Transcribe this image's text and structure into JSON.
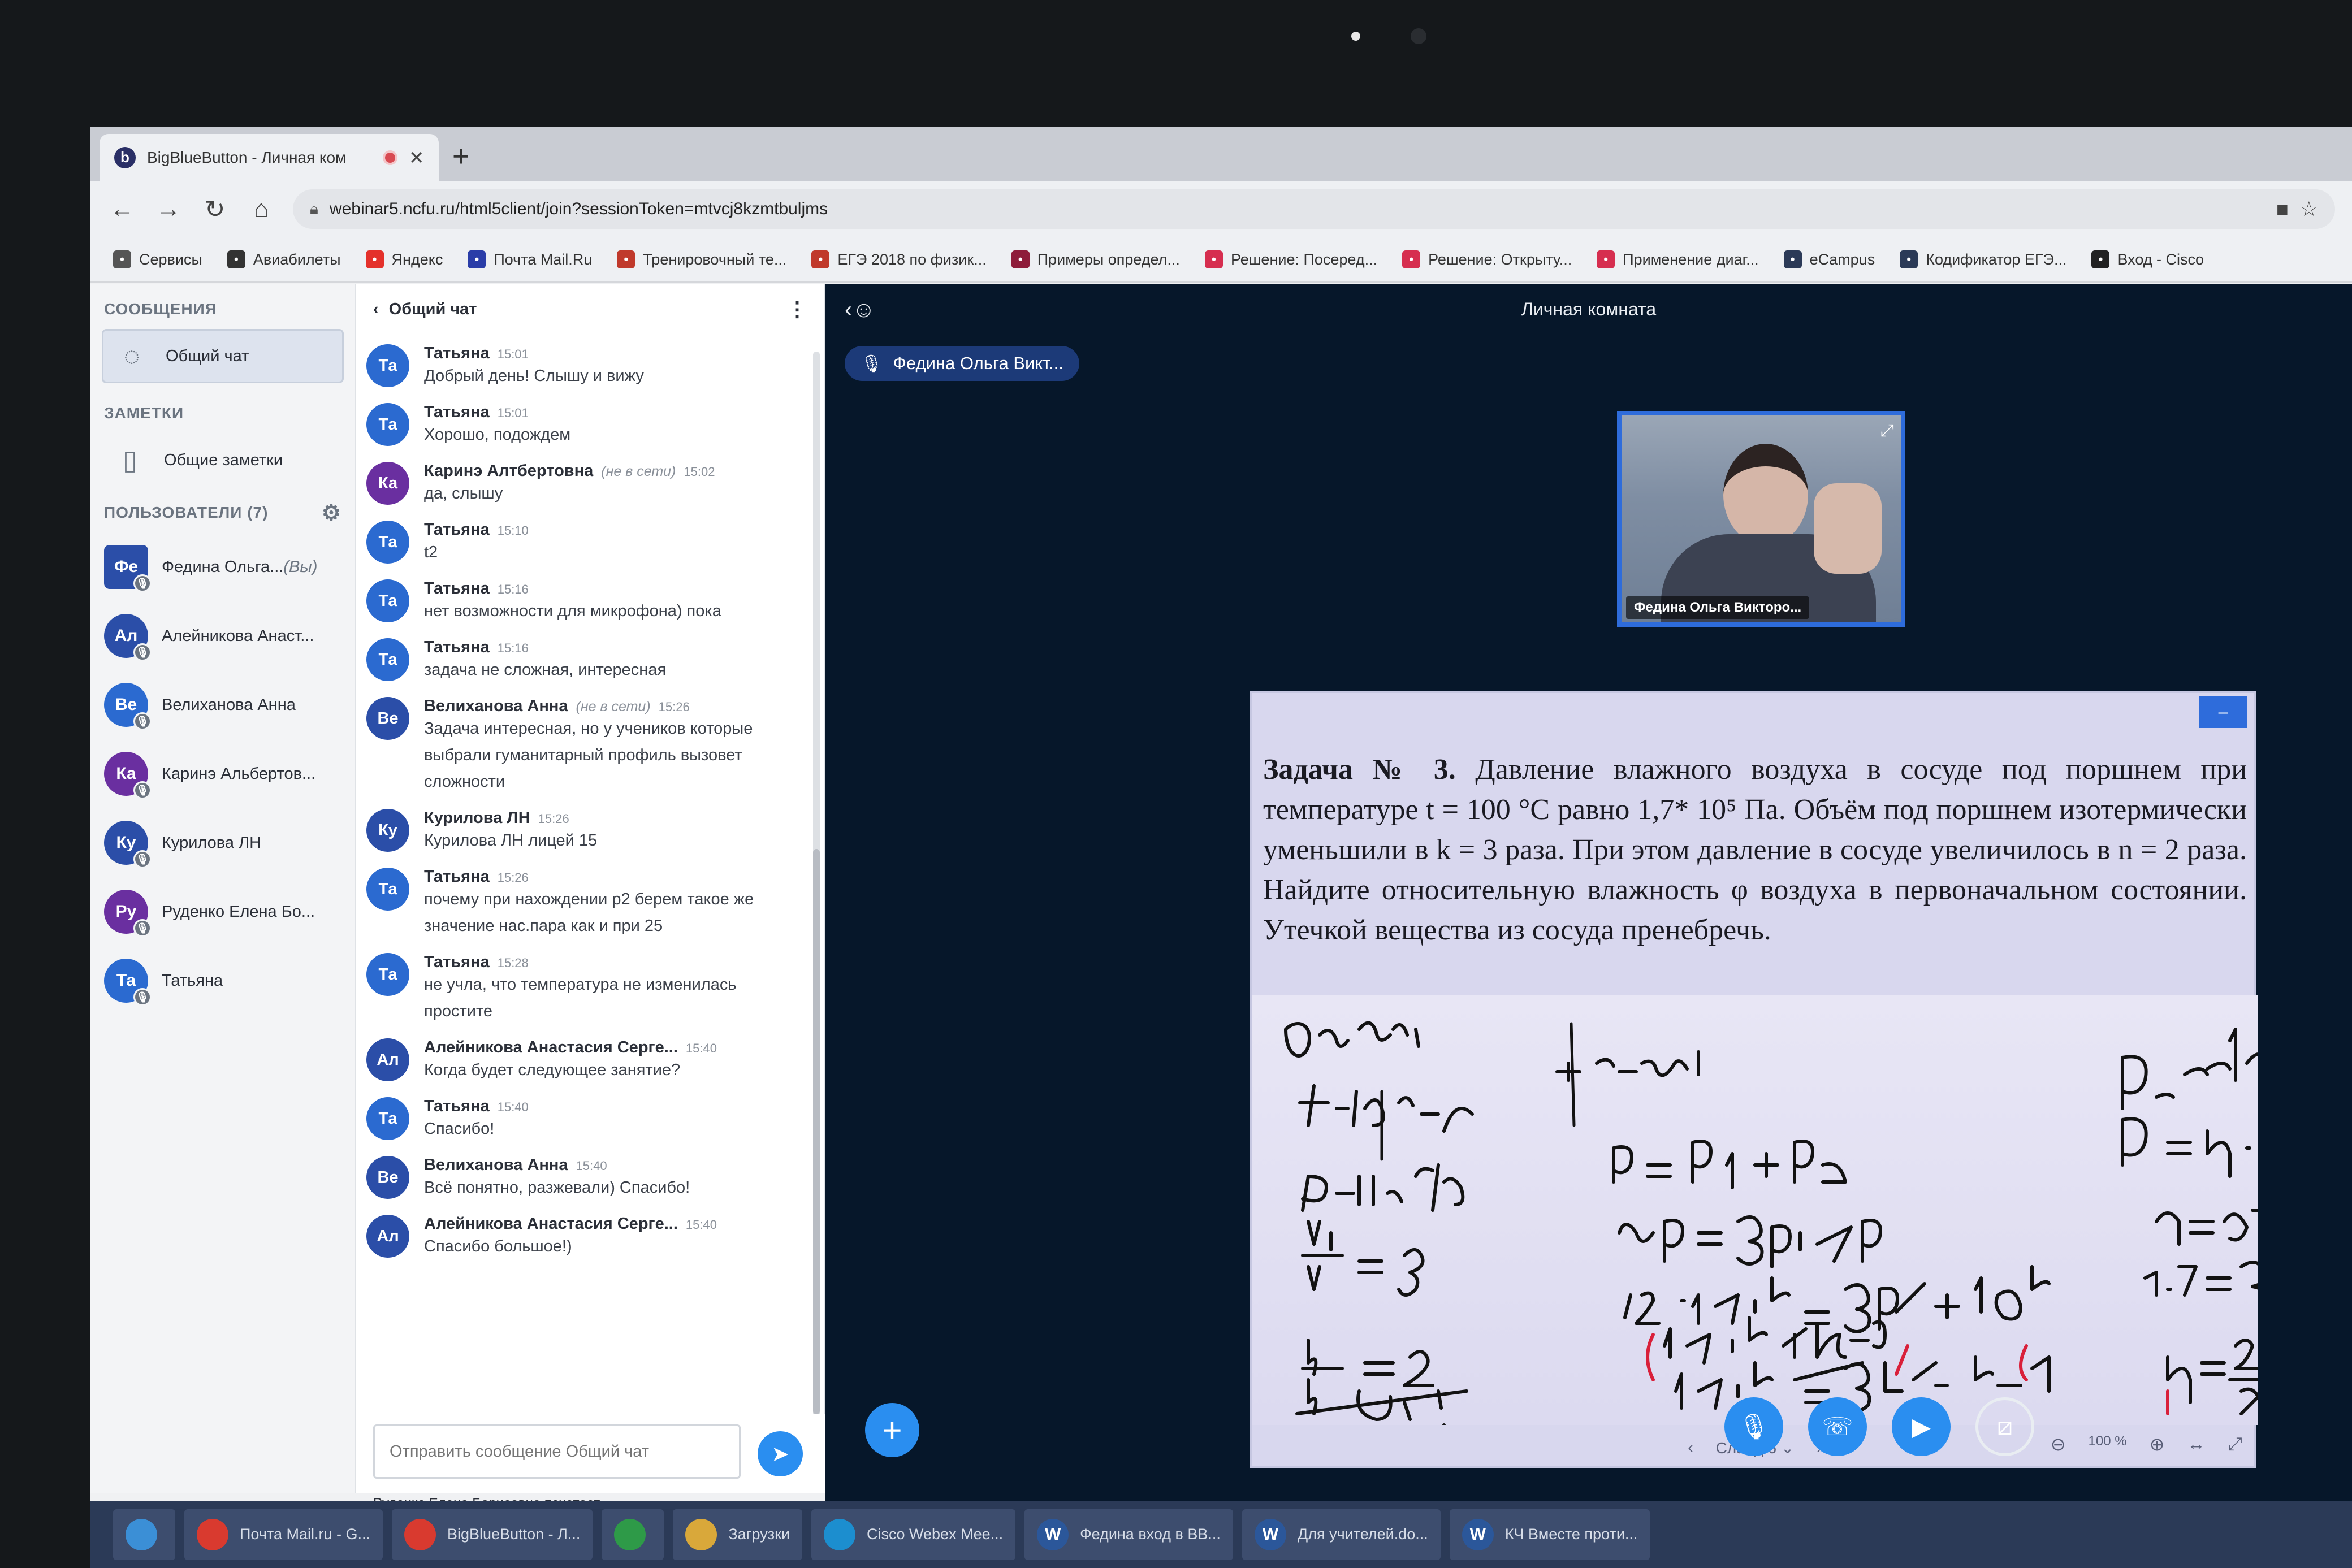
{
  "browser": {
    "tab_title": "BigBlueButton - Личная ком",
    "tab_favicon": "b",
    "url": "webinar5.ncfu.ru/html5client/join?sessionToken=mtvcj8kzmtbuljms",
    "bookmarks": [
      {
        "label": "Сервисы",
        "icon": "apps-icon",
        "color": "#555555"
      },
      {
        "label": "Авиабилеты",
        "icon": "plane-icon",
        "color": "#333333"
      },
      {
        "label": "Яндекс",
        "icon": "yandex-icon",
        "color": "#e4312b"
      },
      {
        "label": "Почта Mail.Ru",
        "icon": "mail-icon",
        "color": "#2a3da8"
      },
      {
        "label": "Тренировочный те...",
        "icon": "ege-icon",
        "color": "#c0392b"
      },
      {
        "label": "ЕГЭ 2018 по физик...",
        "icon": "ege-icon",
        "color": "#c0392b"
      },
      {
        "label": "Примеры определ...",
        "icon": "doc-icon",
        "color": "#8e1c3a"
      },
      {
        "label": "Решение: Посеред...",
        "icon": "thumb-icon",
        "color": "#d62e4f"
      },
      {
        "label": "Решение: Открыту...",
        "icon": "thumb-icon",
        "color": "#d62e4f"
      },
      {
        "label": "Применение диаг...",
        "icon": "thumb-icon",
        "color": "#d62e4f"
      },
      {
        "label": "eCampus",
        "icon": "ecampus-icon",
        "color": "#2b3a57"
      },
      {
        "label": "Кодификатор ЕГЭ...",
        "icon": "codifier-icon",
        "color": "#2b3a57"
      },
      {
        "label": "Вход - Cisco",
        "icon": "cisco-icon",
        "color": "#222222"
      }
    ]
  },
  "nav": {
    "messages_header": "СООБЩЕНИЯ",
    "public_chat": "Общий чат",
    "notes_header": "ЗАМЕТКИ",
    "shared_notes": "Общие заметки",
    "users_header": "ПОЛЬЗОВАТЕЛИ (7)",
    "users": [
      {
        "initials": "Фе",
        "name": "Федина Ольга...",
        "suffix": "(Вы)",
        "color": "#2b4ea8",
        "square": true
      },
      {
        "initials": "Ал",
        "name": "Алейникова Анаст...",
        "suffix": "",
        "color": "#2b4ea8",
        "square": false
      },
      {
        "initials": "Ве",
        "name": "Велиханова Анна",
        "suffix": "",
        "color": "#2b6ad0",
        "square": false
      },
      {
        "initials": "Ка",
        "name": "Каринэ Альбертов...",
        "suffix": "",
        "color": "#6a2fa0",
        "square": false
      },
      {
        "initials": "Ку",
        "name": "Курилова ЛН",
        "suffix": "",
        "color": "#2b4ea8",
        "square": false
      },
      {
        "initials": "Ру",
        "name": "Руденко Елена Бо...",
        "suffix": "",
        "color": "#6a2fa0",
        "square": false
      },
      {
        "initials": "Та",
        "name": "Татьяна",
        "suffix": "",
        "color": "#2b6ad0",
        "square": false
      }
    ]
  },
  "chat": {
    "title": "Общий чат",
    "messages": [
      {
        "initials": "Та",
        "color": "#2b6ad0",
        "name": "Татьяна",
        "offline": "",
        "time": "15:01",
        "text": "Добрый день! Слышу и вижу"
      },
      {
        "initials": "Та",
        "color": "#2b6ad0",
        "name": "Татьяна",
        "offline": "",
        "time": "15:01",
        "text": "Хорошо, подождем"
      },
      {
        "initials": "Ка",
        "color": "#6a2fa0",
        "name": "Каринэ Алтбертовна",
        "offline": "(не в сети)",
        "time": "15:02",
        "text": "да, слышу"
      },
      {
        "initials": "Та",
        "color": "#2b6ad0",
        "name": "Татьяна",
        "offline": "",
        "time": "15:10",
        "text": "t2"
      },
      {
        "initials": "Та",
        "color": "#2b6ad0",
        "name": "Татьяна",
        "offline": "",
        "time": "15:16",
        "text": "нет возможности для микрофона) пока"
      },
      {
        "initials": "Та",
        "color": "#2b6ad0",
        "name": "Татьяна",
        "offline": "",
        "time": "15:16",
        "text": "задача не сложная, интересная"
      },
      {
        "initials": "Ве",
        "color": "#2b4ea8",
        "name": "Велиханова Анна",
        "offline": "(не в сети)",
        "time": "15:26",
        "text": "Задача интересная, но у учеников которые выбрали гуманитарный профиль вызовет сложности"
      },
      {
        "initials": "Ку",
        "color": "#2b4ea8",
        "name": "Курилова ЛН",
        "offline": "",
        "time": "15:26",
        "text": "Курилова ЛН лицей 15"
      },
      {
        "initials": "Та",
        "color": "#2b6ad0",
        "name": "Татьяна",
        "offline": "",
        "time": "15:26",
        "text": "почему при нахождении p2 берем такое же значение нас.пара как и при 25"
      },
      {
        "initials": "Та",
        "color": "#2b6ad0",
        "name": "Татьяна",
        "offline": "",
        "time": "15:28",
        "text": "не учла, что температура не изменилась простите"
      },
      {
        "initials": "Ал",
        "color": "#2b4ea8",
        "name": "Алейникова Анастасия Серге...",
        "offline": "",
        "time": "15:40",
        "text": "Когда будет следующее занятие?"
      },
      {
        "initials": "Та",
        "color": "#2b6ad0",
        "name": "Татьяна",
        "offline": "",
        "time": "15:40",
        "text": "Спасибо!"
      },
      {
        "initials": "Ве",
        "color": "#2b4ea8",
        "name": "Велиханова Анна",
        "offline": "",
        "time": "15:40",
        "text": "Всё понятно, разжевали) Спасибо!"
      },
      {
        "initials": "Ал",
        "color": "#2b4ea8",
        "name": "Алейникова Анастасия Серге...",
        "offline": "",
        "time": "15:40",
        "text": "Спасибо большое!)"
      }
    ],
    "input_placeholder": "Отправить сообщение Общий чат",
    "typing": "Руденко Елена Борисовна печатает"
  },
  "main": {
    "room_title": "Личная комната",
    "talker": "Федина Ольга Викт...",
    "webcam_label": "Федина Ольга Викторо...",
    "slide": {
      "task_label": "Задача № 3.",
      "task_text": "Давление влажного воздуха в сосуде под поршнем при температуре t = 100 °С равно 1,7* 10⁵ Па. Объём под поршнем изотермически уменьшили в k = 3 раза. При этом давление в сосуде увеличилось в n = 2 раза. Найдите относительную влажность φ воздуха в первоначальном состоянии. Утечкой вещества из сосуда пренебречь.",
      "slide_label": "Слайд 6",
      "zoom": "100 %"
    }
  },
  "taskbar": [
    {
      "label": "",
      "icon": "windows-icon",
      "color": "#3b8fd6"
    },
    {
      "label": "Почта Mail.ru - G...",
      "icon": "chrome-icon",
      "color": "#d93a2f"
    },
    {
      "label": "BigBlueButton - Л...",
      "icon": "chrome-icon",
      "color": "#d93a2f"
    },
    {
      "label": "",
      "icon": "chrome-icon",
      "color": "#2e9a48"
    },
    {
      "label": "Загрузки",
      "icon": "folder-icon",
      "color": "#d9a83a"
    },
    {
      "label": "Cisco Webex Mee...",
      "icon": "webex-icon",
      "color": "#1c8ecf"
    },
    {
      "label": "Федина вход в ВВ...",
      "icon": "word-icon",
      "color": "#2b579a"
    },
    {
      "label": "Для учителей.do...",
      "icon": "word-icon",
      "color": "#2b579a"
    },
    {
      "label": "КЧ Вместе проти...",
      "icon": "word-icon",
      "color": "#2b579a"
    }
  ]
}
